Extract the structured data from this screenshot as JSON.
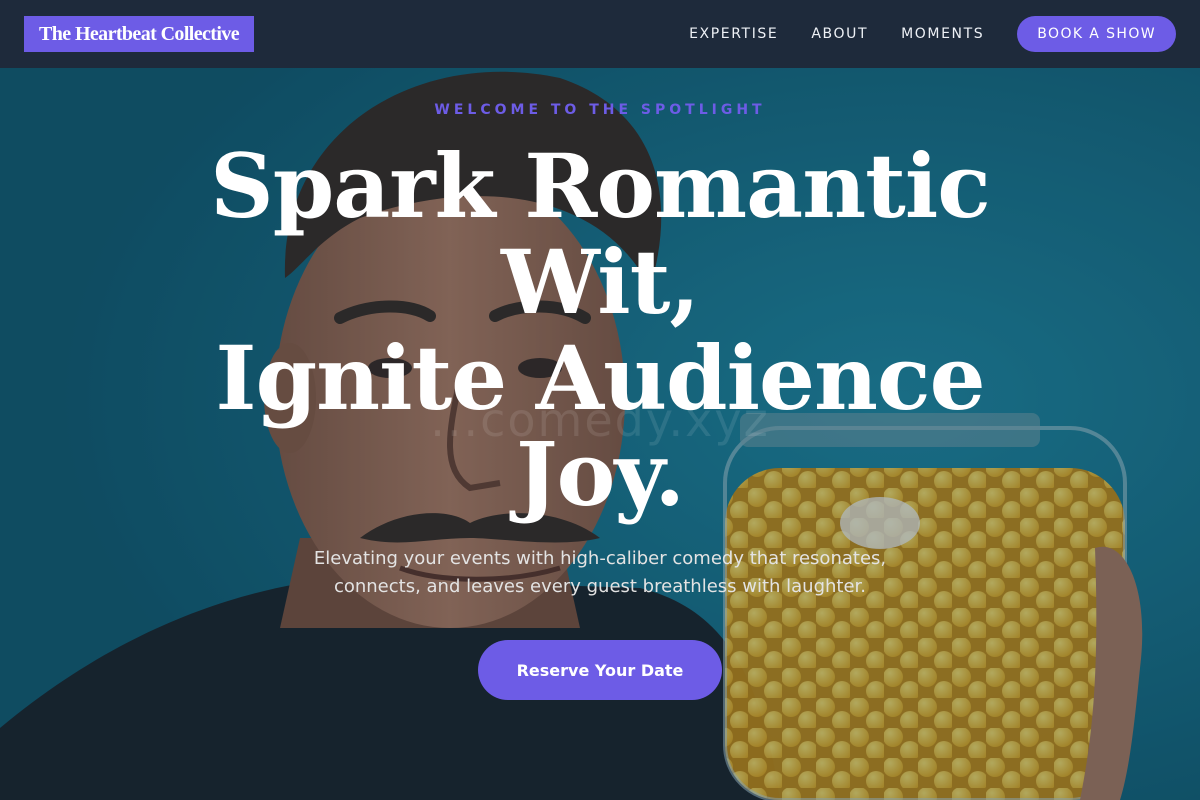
{
  "brand": {
    "name": "The Heartbeat Collective"
  },
  "nav": {
    "links": [
      "EXPERTISE",
      "ABOUT",
      "MOMENTS"
    ],
    "cta_label": "BOOK A SHOW"
  },
  "hero": {
    "eyebrow": "WELCOME TO THE SPOTLIGHT",
    "headline": [
      "Spark Romantic",
      "Wit,",
      "Ignite Audience",
      "Joy."
    ],
    "subtext": [
      "Elevating your events with high-caliber comedy that resonates,",
      "connects, and leaves every guest breathless with laughter."
    ],
    "cta_label": "Reserve Your Date",
    "watermark": "...comedy.xyz"
  },
  "colors": {
    "accent": "#6d5ce6",
    "header_bg": "#1e2a3b",
    "hero_bg": "#17677f"
  }
}
